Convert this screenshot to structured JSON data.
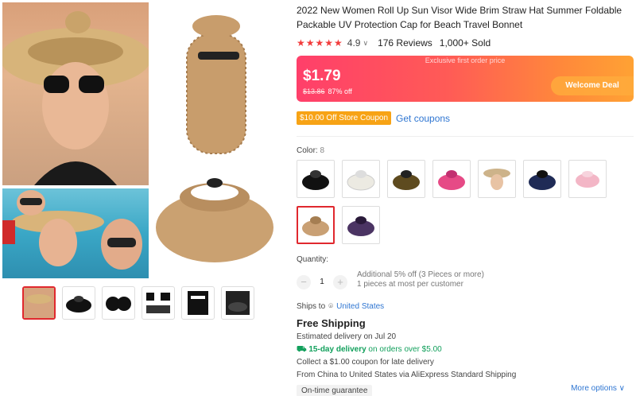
{
  "product": {
    "title": "2022 New Women Roll Up Sun Visor Wide Brim Straw Hat Summer Foldable Packable UV Protection Cap for Beach Travel Bonnet",
    "stars": "★★★★★",
    "rating": "4.9",
    "reviews": "176 Reviews",
    "sold": "1,000+ Sold"
  },
  "price": {
    "exclusive_label": "Exclusive first order price",
    "current": "$1.79",
    "original": "$13.86",
    "discount": "87% off",
    "welcome_deal": "Welcome Deal"
  },
  "coupon": {
    "store_coupon": "$10.00 Off Store Coupon",
    "get_coupons": "Get coupons"
  },
  "color": {
    "label": "Color:",
    "count": "8",
    "swatch_colors": [
      "#111111",
      "#f2f0ea",
      "#5e4b1f",
      "#e64a86",
      "#cdb38a",
      "#1f2b56",
      "#f3b6c6",
      "#c9a074",
      "#4b3463"
    ]
  },
  "quantity": {
    "label": "Quantity:",
    "minus": "−",
    "value": "1",
    "plus": "+",
    "note1": "Additional 5% off (3 Pieces or more)",
    "note2": "1 pieces at most per customer"
  },
  "shipping": {
    "ships_to_label": "Ships to",
    "country": "United States",
    "free": "Free Shipping",
    "estimated_prefix": "Estimated delivery on",
    "estimated_date": "Jul 20",
    "fast_label": "15-day delivery",
    "fast_suffix": "on orders over $5.00",
    "late_coupon": "Collect a $1.00 coupon for late delivery",
    "from_prefix": "From",
    "from_country": "China",
    "to_word": "to",
    "to_country": "United States",
    "via": "via AliExpress Standard Shipping",
    "ontime": "On-time guarantee",
    "more_options": "More options ∨"
  },
  "accent": "#e0282e",
  "link_color": "#2f76d2"
}
